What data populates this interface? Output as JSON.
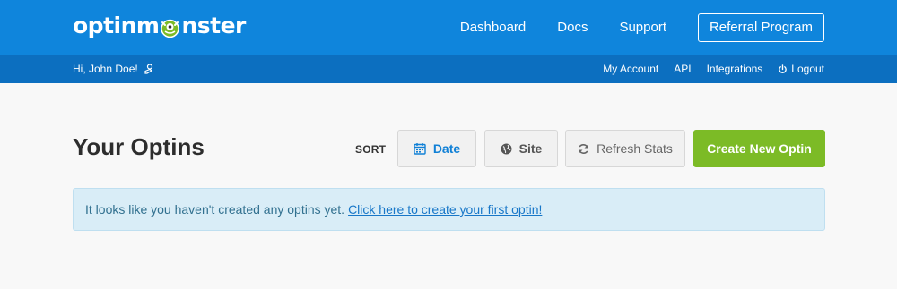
{
  "header": {
    "logo_text_a": "optinm",
    "logo_text_b": "nster",
    "nav": [
      "Dashboard",
      "Docs",
      "Support"
    ],
    "referral_label": "Referral Program"
  },
  "subheader": {
    "greeting": "Hi, John Doe!",
    "links": [
      "My Account",
      "API",
      "Integrations",
      "Logout"
    ]
  },
  "main": {
    "title": "Your Optins",
    "sort_label": "SORT",
    "buttons": {
      "date": "Date",
      "site": "Site",
      "refresh": "Refresh Stats",
      "create": "Create New Optin"
    },
    "notice": {
      "text": "It looks like you haven't created any optins yet.",
      "link": "Click here to create your first optin!"
    }
  },
  "colors": {
    "header_bg": "#0f85dc",
    "subheader_bg": "#0c6fc0",
    "accent_green": "#7cbb26",
    "notice_bg": "#d9edf7"
  }
}
